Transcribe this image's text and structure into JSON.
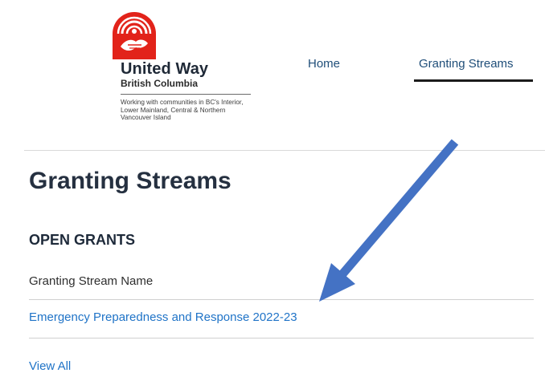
{
  "brand": {
    "name": "United Way",
    "region": "British Columbia",
    "tagline": "Working with communities in BC's Interior, Lower Mainland, Central & Northern Vancouver Island",
    "logo_icon": "united-way-hand-logo",
    "logo_color": "#e2231a"
  },
  "nav": {
    "items": [
      {
        "label": "Home",
        "active": false
      },
      {
        "label": "Granting Streams",
        "active": true
      }
    ]
  },
  "main": {
    "title": "Granting Streams",
    "section_heading": "OPEN GRANTS",
    "column_header": "Granting Stream Name",
    "grants": [
      {
        "name": "Emergency Preparedness and Response 2022-23"
      }
    ],
    "view_all_label": "View All"
  },
  "annotation": {
    "icon": "arrow-icon",
    "color": "#4472c4"
  },
  "colors": {
    "link": "#1f73c7",
    "nav_link": "#1f4e79"
  }
}
